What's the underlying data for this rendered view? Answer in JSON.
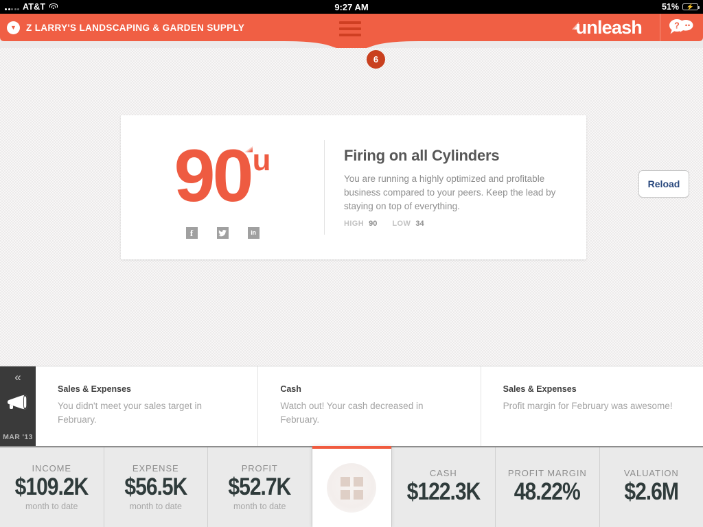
{
  "status_bar": {
    "carrier": "AT&T",
    "time": "9:27 AM",
    "battery_percent": "51%"
  },
  "header": {
    "account_name": "Z LARRY'S LANDSCAPING & GARDEN SUPPLY",
    "logo_text": "unleash",
    "menu_badge_count": "6",
    "accent_color": "#f05f44",
    "menu_icon": "hamburger-icon",
    "help_icon": "help-speech-bubbles-icon",
    "account_caret_icon": "chevron-down-icon"
  },
  "score_card": {
    "score": "90",
    "score_unit": "u",
    "title": "Firing on all Cylinders",
    "description": "You are running a highly optimized and profitable business compared to your peers. Keep the lead by staying on top of everything.",
    "high_label": "HIGH",
    "high_value": "90",
    "low_label": "LOW",
    "low_value": "34",
    "score_color": "#ee5b41",
    "social": [
      {
        "name": "facebook-share-icon",
        "glyph": "f"
      },
      {
        "name": "twitter-share-icon",
        "glyph": ""
      },
      {
        "name": "linkedin-share-icon",
        "glyph": "in"
      }
    ]
  },
  "reload_button": {
    "label": "Reload"
  },
  "insights": {
    "side_panel": {
      "collapse_icon": "double-chevron-left-icon",
      "announce_icon": "megaphone-icon",
      "month_label": "MAR '13"
    },
    "cards": [
      {
        "title": "Sales & Expenses",
        "text": "You didn't meet your sales target in February."
      },
      {
        "title": "Cash",
        "text": "Watch out! Your cash decreased in February."
      },
      {
        "title": "Sales & Expenses",
        "text": "Profit margin for February was awesome!"
      }
    ]
  },
  "metrics": {
    "grid_tile": {
      "icon": "grid-apps-icon",
      "selected": true,
      "accent_color": "#f05b3f"
    },
    "items": [
      {
        "label": "INCOME",
        "value": "$109.2K",
        "sub": "month to date"
      },
      {
        "label": "EXPENSE",
        "value": "$56.5K",
        "sub": "month to date"
      },
      {
        "label": "PROFIT",
        "value": "$52.7K",
        "sub": "month to date"
      },
      {
        "label": "CASH",
        "value": "$122.3K",
        "sub": ""
      },
      {
        "label": "PROFIT MARGIN",
        "value": "48.22%",
        "sub": ""
      },
      {
        "label": "VALUATION",
        "value": "$2.6M",
        "sub": ""
      }
    ]
  }
}
